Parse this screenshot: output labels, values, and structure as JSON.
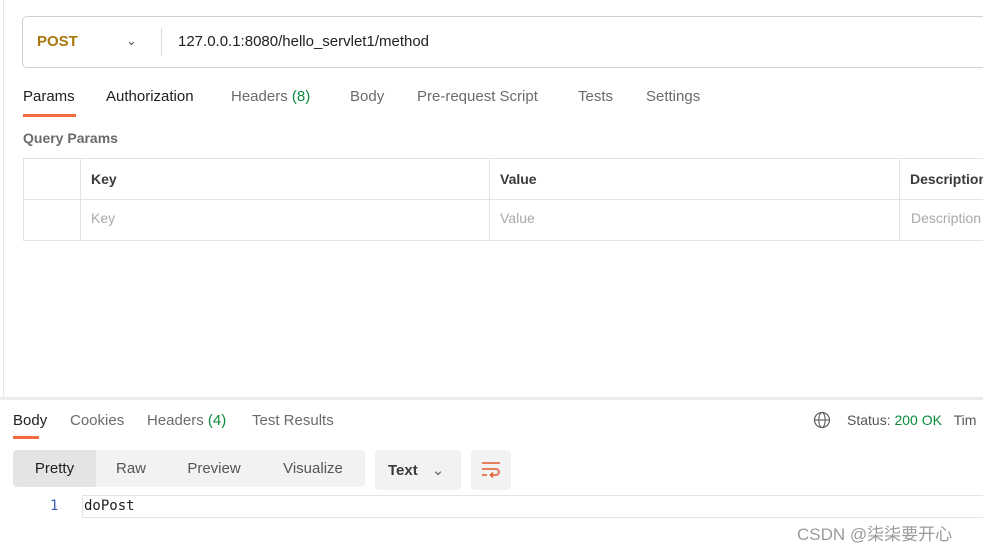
{
  "request": {
    "method": "POST",
    "url": "127.0.0.1:8080/hello_servlet1/method"
  },
  "request_tabs": [
    {
      "label": "Params"
    },
    {
      "label": "Authorization"
    },
    {
      "label": "Headers",
      "count": "(8)"
    },
    {
      "label": "Body"
    },
    {
      "label": "Pre-request Script"
    },
    {
      "label": "Tests"
    },
    {
      "label": "Settings"
    }
  ],
  "query_params": {
    "title": "Query Params",
    "headers": [
      "Key",
      "Value",
      "Description"
    ],
    "placeholders": [
      "Key",
      "Value",
      "Description"
    ]
  },
  "response_tabs": [
    {
      "label": "Body"
    },
    {
      "label": "Cookies"
    },
    {
      "label": "Headers",
      "count": "(4)"
    },
    {
      "label": "Test Results"
    }
  ],
  "status": {
    "label": "Status:",
    "value": "200 OK",
    "next": "Tim"
  },
  "view_modes": [
    "Pretty",
    "Raw",
    "Preview",
    "Visualize"
  ],
  "format": "Text",
  "response_body": {
    "line": "1",
    "content": "doPost"
  },
  "watermark": "CSDN @柒柒要开心",
  "colors": {
    "accent": "#f26b3a",
    "method": "#a8780c",
    "ok": "#0a8a3a"
  }
}
